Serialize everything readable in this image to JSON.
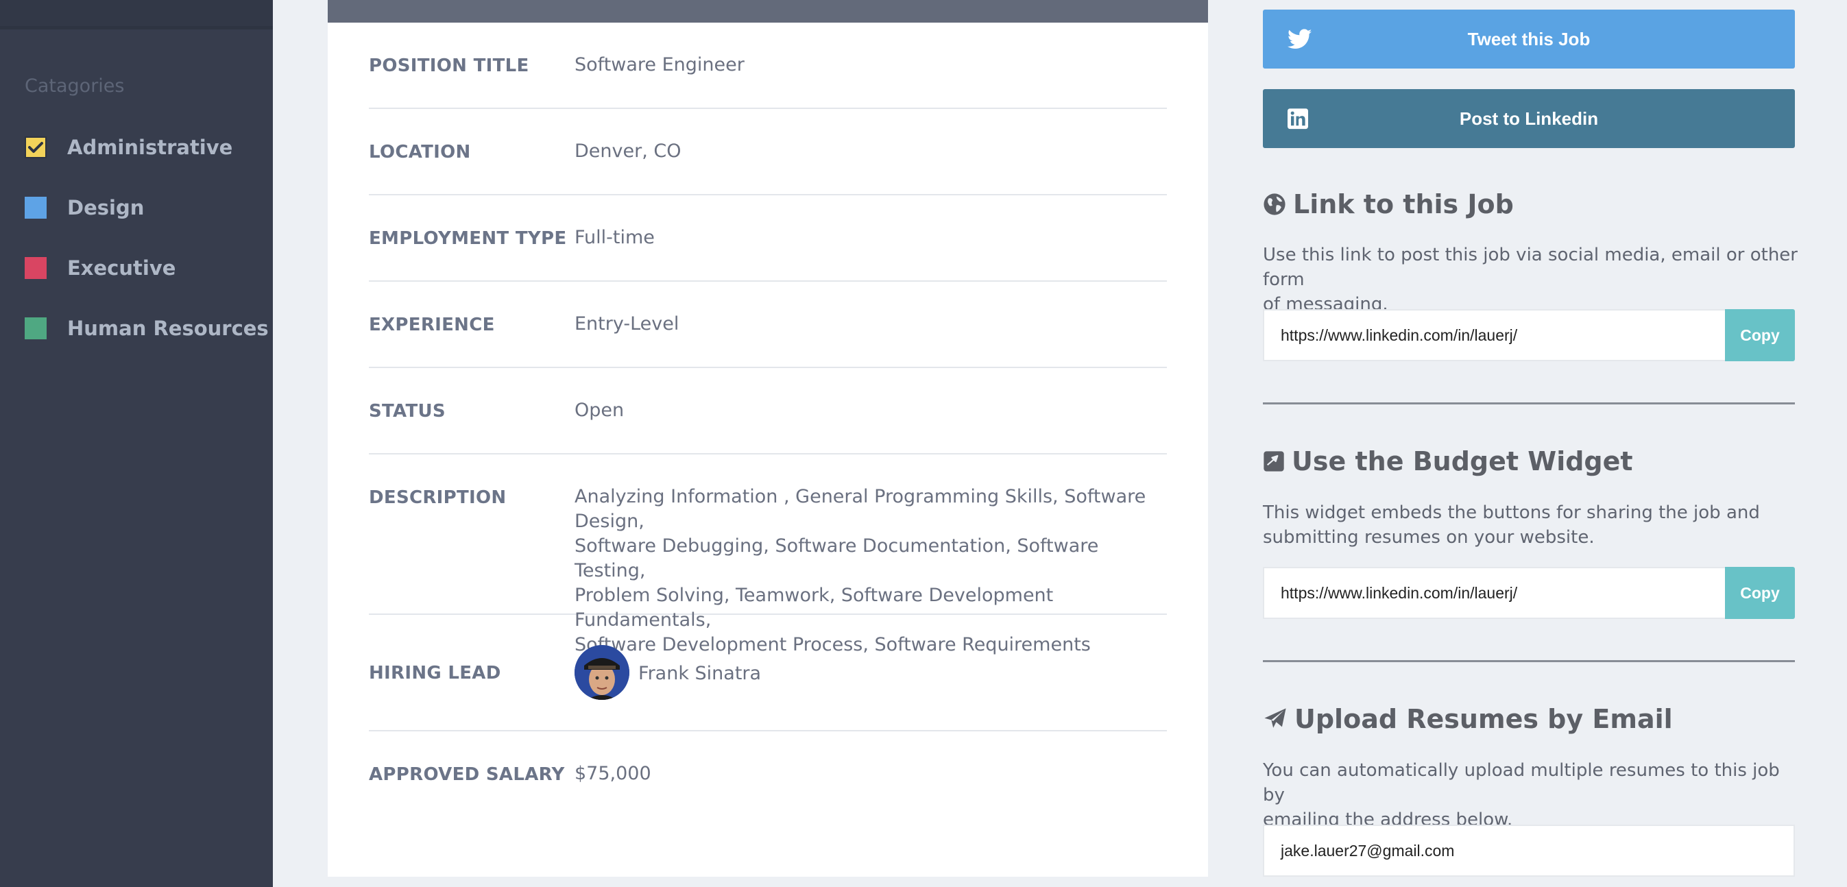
{
  "sidebar": {
    "heading": "Catagories",
    "categories": [
      {
        "label": "Administrative",
        "color": "#f3d35a",
        "checked": true
      },
      {
        "label": "Design",
        "color": "#5ea3e6",
        "checked": false
      },
      {
        "label": "Executive",
        "color": "#d94562",
        "checked": false
      },
      {
        "label": "Human Resources",
        "color": "#4fa882",
        "checked": false
      }
    ]
  },
  "job": {
    "position_title_label": "POSITION TITLE",
    "position_title": "Software Engineer",
    "location_label": "LOCATION",
    "location": "Denver, CO",
    "employment_type_label": "EMPLOYMENT TYPE",
    "employment_type": "Full-time",
    "experience_label": "EXPERIENCE",
    "experience": "Entry-Level",
    "status_label": "STATUS",
    "status": "Open",
    "description_label": "DESCRIPTION",
    "description_lines": [
      "Analyzing Information , General Programming Skills, Software Design,",
      "Software Debugging, Software Documentation, Software Testing,",
      "Problem Solving, Teamwork, Software Development Fundamentals,",
      "Software Development Process, Software Requirements"
    ],
    "hiring_lead_label": "HIRING LEAD",
    "hiring_lead": "Frank Sinatra",
    "salary_label": "APPROVED SALARY",
    "salary": "$75,000"
  },
  "share": {
    "tweet_label": "Tweet this Job",
    "linkedin_label": "Post to Linkedin",
    "twitter_color": "#5aa3e3",
    "linkedin_color": "#467a95"
  },
  "link_section": {
    "title": "Link to this Job",
    "desc_lines": [
      "Use this link to post this job via social media, email or other form",
      "of messaging."
    ],
    "url": "https://www.linkedin.com/in/lauerj/",
    "copy_label": "Copy"
  },
  "widget_section": {
    "title": "Use the Budget Widget",
    "desc_lines": [
      "This widget embeds the buttons for sharing the job and",
      "submitting resumes on your website."
    ],
    "url": "https://www.linkedin.com/in/lauerj/",
    "copy_label": "Copy"
  },
  "email_section": {
    "title": "Upload Resumes by Email",
    "desc_lines": [
      "You can automatically upload multiple resumes to this job by",
      "emailing the address below."
    ],
    "email": "jake.lauer27@gmail.com"
  },
  "icons": {
    "check": "check-icon",
    "twitter": "twitter-icon",
    "linkedin": "linkedin-icon",
    "globe": "globe-icon",
    "widget": "widget-icon",
    "paper_plane": "paper-plane-icon"
  },
  "accent_copy_color": "#68c2c7"
}
